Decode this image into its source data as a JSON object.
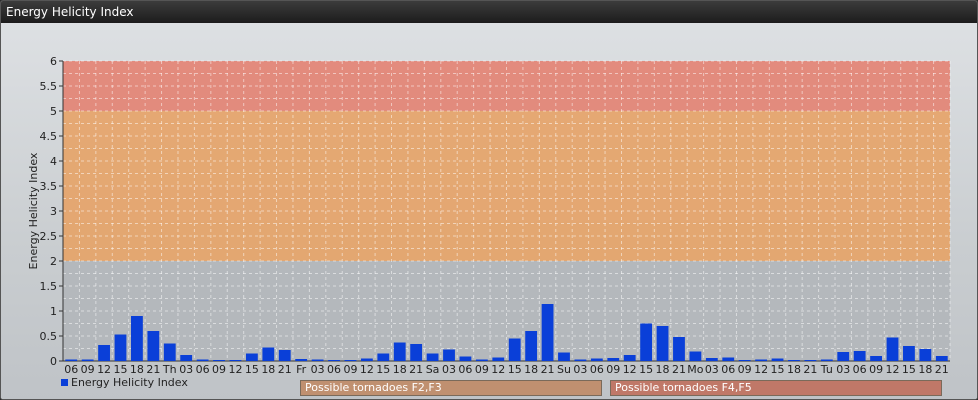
{
  "window": {
    "title": "Energy Helicity Index"
  },
  "chart_data": {
    "type": "bar",
    "ylabel": "Energy Helicity Index",
    "ylim": [
      0,
      6
    ],
    "yticks": [
      "0",
      "0.5",
      "1",
      "1.5",
      "2",
      "2.5",
      "3",
      "3.5",
      "4",
      "4.5",
      "5",
      "5.5",
      "6"
    ],
    "grid": true,
    "legend_position": "bottom-left",
    "categories": [
      "06",
      "09",
      "12",
      "15",
      "18",
      "21",
      "Th",
      "03",
      "06",
      "09",
      "12",
      "15",
      "18",
      "21",
      "Fr",
      "03",
      "06",
      "09",
      "12",
      "15",
      "18",
      "21",
      "Sa",
      "03",
      "06",
      "09",
      "12",
      "15",
      "18",
      "21",
      "Su",
      "03",
      "06",
      "09",
      "12",
      "15",
      "18",
      "21",
      "Mo",
      "03",
      "06",
      "09",
      "12",
      "15",
      "18",
      "21",
      "Tu",
      "03",
      "06",
      "09",
      "12",
      "15",
      "18",
      "21"
    ],
    "series": [
      {
        "name": "Energy Helicity Index",
        "color": "#0a3fd8",
        "values": [
          0.03,
          0.03,
          0.32,
          0.53,
          0.9,
          0.6,
          0.35,
          0.12,
          0.03,
          0.02,
          0.02,
          0.15,
          0.27,
          0.22,
          0.04,
          0.03,
          0.02,
          0.02,
          0.05,
          0.15,
          0.37,
          0.34,
          0.15,
          0.23,
          0.09,
          0.03,
          0.07,
          0.45,
          0.6,
          1.14,
          0.17,
          0.03,
          0.05,
          0.06,
          0.12,
          0.75,
          0.7,
          0.48,
          0.19,
          0.06,
          0.07,
          0.02,
          0.03,
          0.05,
          0.02,
          0.02,
          0.03,
          0.18,
          0.2,
          0.1,
          0.47,
          0.3,
          0.24,
          0.1
        ]
      }
    ],
    "bands": [
      {
        "from": 2,
        "to": 5,
        "label": "Possible tornadoes F2,F3",
        "color": "#e8a060"
      },
      {
        "from": 5,
        "to": 6,
        "label": "Possible tornadoes F4,F5",
        "color": "#e47c6c"
      }
    ]
  }
}
